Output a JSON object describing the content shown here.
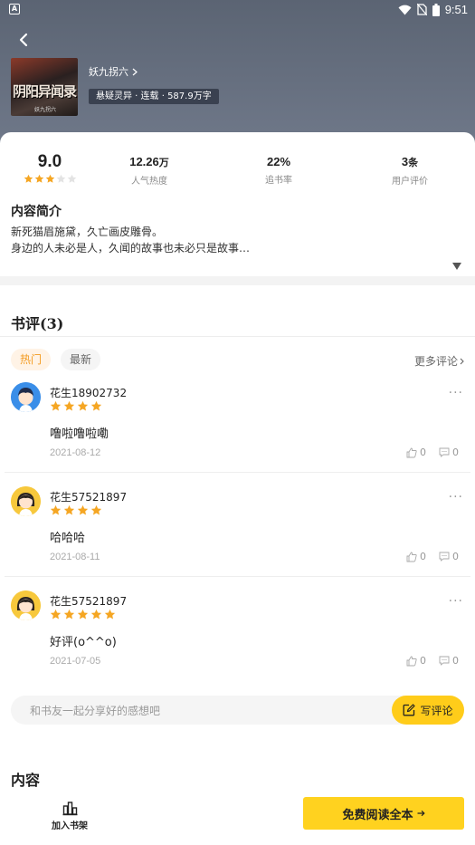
{
  "status_bar": {
    "left_icon": "A",
    "time": "9:51",
    "icons": [
      "wifi-icon",
      "no-sim-icon",
      "battery-icon"
    ]
  },
  "book": {
    "cover_title": "阴阳异闻录",
    "cover_author": "妖九拐六",
    "author": "妖九拐六",
    "tags": "悬疑灵异 · 连载 · 587.9万字"
  },
  "stats": {
    "score": "9.0",
    "score_stars": 3,
    "popularity_value": "12.26",
    "popularity_unit": "万",
    "popularity_label": "人气热度",
    "follow_value": "22%",
    "follow_label": "追书率",
    "reviews_value": "3",
    "reviews_unit": "条",
    "reviews_label": "用户评价"
  },
  "intro": {
    "title": "内容简介",
    "line1": "新死猫眉施黛，久亡画皮雕骨。",
    "line2": "身边的人未必是人，久闻的故事也未必只是故事…"
  },
  "reviews_section": {
    "title": "书评(3)",
    "tabs": [
      "热门",
      "最新"
    ],
    "more": "更多评论",
    "comment_placeholder": "和书友一起分享好的感想吧",
    "write_label": "写评论"
  },
  "reviews": [
    {
      "user": "花生18902732",
      "stars": 4,
      "text": "噜啦噜啦嘞",
      "date": "2021-08-12",
      "likes": "0",
      "comments": "0",
      "avatar_color": "#3a8ee8"
    },
    {
      "user": "花生57521897",
      "stars": 4,
      "text": "哈哈哈",
      "date": "2021-08-11",
      "likes": "0",
      "comments": "0",
      "avatar_color": "#f7c83c"
    },
    {
      "user": "花生57521897",
      "stars": 5,
      "text": "好评(o^^o)",
      "date": "2021-07-05",
      "likes": "0",
      "comments": "0",
      "avatar_color": "#f7c83c"
    }
  ],
  "content_section": {
    "title": "内容"
  },
  "bottom_bar": {
    "shelf_label": "加入书架",
    "read_label": "免费阅读全本"
  },
  "colors": {
    "accent": "#ffd21f",
    "star": "#f5a623",
    "header": "#5b6473"
  }
}
